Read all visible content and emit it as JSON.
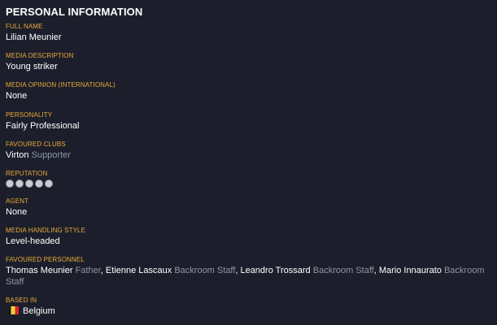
{
  "header": {
    "title": "PERSONAL INFORMATION"
  },
  "fields": {
    "full_name": {
      "label": "FULL NAME",
      "value": "Lilian Meunier"
    },
    "media_description": {
      "label": "MEDIA DESCRIPTION",
      "value": "Young striker"
    },
    "media_opinion": {
      "label": "MEDIA OPINION (INTERNATIONAL)",
      "value": "None"
    },
    "personality": {
      "label": "PERSONALITY",
      "value": "Fairly Professional"
    },
    "favoured_clubs": {
      "label": "FAVOURED CLUBS",
      "club": "Virton",
      "role": "Supporter"
    },
    "reputation": {
      "label": "REPUTATION",
      "stars": 5
    },
    "agent": {
      "label": "AGENT",
      "value": "None"
    },
    "media_handling": {
      "label": "MEDIA HANDLING STYLE",
      "value": "Level-headed"
    },
    "favoured_personnel": {
      "label": "FAVOURED PERSONNEL",
      "people": [
        {
          "name": "Thomas Meunier",
          "role": "Father",
          "sep": ", "
        },
        {
          "name": "Etienne Lascaux",
          "role": "Backroom Staff",
          "sep": ", "
        },
        {
          "name": "Leandro Trossard",
          "role": "Backroom Staff",
          "sep": ", "
        },
        {
          "name": "Mario Innaurato",
          "role": "Backroom Staff",
          "sep": ""
        }
      ]
    },
    "based_in": {
      "label": "BASED IN",
      "value": "Belgium",
      "flag_icon": "belgium-flag-icon"
    }
  },
  "colors": {
    "background": "#1c1f2b",
    "label": "#e7a93a",
    "value": "#ffffff",
    "muted": "#8d95a8"
  }
}
